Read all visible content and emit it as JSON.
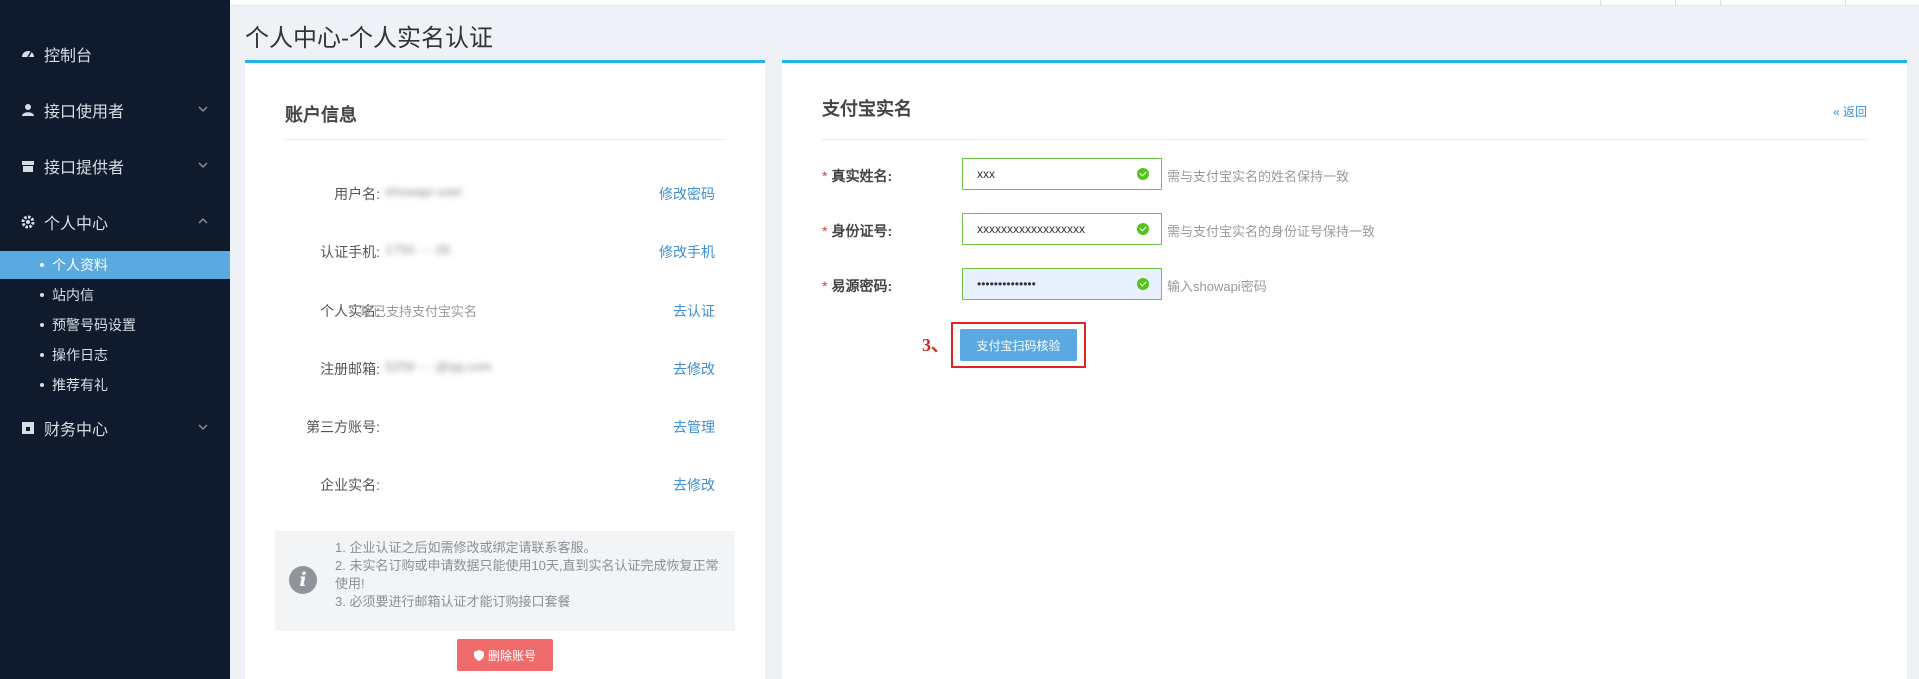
{
  "sidebar": {
    "items": [
      {
        "label": "控制台",
        "icon": "dashboard-icon"
      },
      {
        "label": "接口使用者",
        "icon": "user-icon"
      },
      {
        "label": "接口提供者",
        "icon": "store-icon"
      },
      {
        "label": "个人中心",
        "icon": "gear-icon"
      },
      {
        "label": "财务中心",
        "icon": "wallet-icon"
      }
    ],
    "sub_items": [
      {
        "label": "个人资料",
        "active": true
      },
      {
        "label": "站内信"
      },
      {
        "label": "预警号码设置"
      },
      {
        "label": "操作日志"
      },
      {
        "label": "推荐有礼"
      }
    ]
  },
  "page": {
    "title": "个人中心-个人实名认证"
  },
  "account": {
    "heading": "账户信息",
    "rows": [
      {
        "label": "用户名:",
        "value": "showapi·user",
        "link": "修改密码"
      },
      {
        "label": "认证手机:",
        "value": "1750·····26",
        "link": "修改手机"
      },
      {
        "label": "个人实名:",
        "value": "现已支持支付宝实名",
        "link": "去认证"
      },
      {
        "label": "注册邮箱:",
        "value": "5259·····@qq.com",
        "link": "去修改"
      },
      {
        "label": "第三方账号:",
        "value": "",
        "link": "去管理"
      },
      {
        "label": "企业实名:",
        "value": "",
        "link": "去修改"
      }
    ],
    "notice": [
      "1. 企业认证之后如需修改或绑定请联系客服。",
      "2. 未实名订购或申请数据只能使用10天,直到实名认证完成恢复正常使用!",
      "3. 必须要进行邮箱认证才能订购接口套餐"
    ],
    "delete_label": "删除账号"
  },
  "alipay": {
    "heading": "支付宝实名",
    "back_label": "« 返回",
    "fields": [
      {
        "label": "真实姓名:",
        "value": "xxx",
        "hint": "需与支付宝实名的姓名保持一致"
      },
      {
        "label": "身份证号:",
        "value": "xxxxxxxxxxxxxxxxxx",
        "hint": "需与支付宝实名的身份证号保持一致"
      },
      {
        "label": "易源密码:",
        "value": "••••••••••••••",
        "hint": "输入showapi密码"
      }
    ],
    "required_mark": "*",
    "step_mark": "3、",
    "scan_button": "支付宝扫码核验"
  },
  "colors": {
    "sidebar_bg": "#0f1b2d",
    "active": "#5aa9e0",
    "accent_top": "#1fb5e8",
    "link": "#3d8fd1",
    "danger": "#f06c6c",
    "valid": "#6cc644"
  }
}
